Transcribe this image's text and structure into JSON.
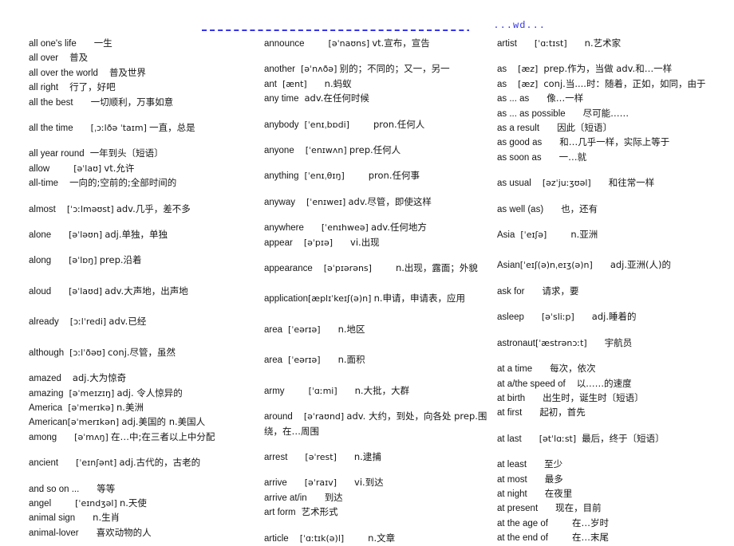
{
  "header": {
    "mark": "...wd...",
    "rule_color": "#3333ee"
  },
  "columns": [
    {
      "name": "column-1",
      "entries": [
        {
          "gap": "none",
          "headword": "all one's life",
          "sp": 3,
          "phonetic": "",
          "definition": "一生"
        },
        {
          "gap": "none",
          "headword": "all over",
          "sp": 2,
          "phonetic": "",
          "definition": "普及"
        },
        {
          "gap": "none",
          "headword": "all over the world",
          "sp": 2,
          "phonetic": "",
          "definition": "普及世界"
        },
        {
          "gap": "none",
          "headword": "all right",
          "sp": 2,
          "phonetic": "",
          "definition": "行了，好吧"
        },
        {
          "gap": "none",
          "headword": "all the best",
          "sp": 3,
          "phonetic": "",
          "definition": "一切顺利，万事如意"
        },
        {
          "gap": "m",
          "headword": "all the time",
          "sp": 3,
          "phonetic": "[ˌɔːlðə ˈtaɪm]",
          "definition": "一直，总是"
        },
        {
          "gap": "m",
          "headword": "all year round",
          "sp": 1,
          "phonetic": "",
          "definition": "一年到头〔短语〕"
        },
        {
          "gap": "none",
          "headword": "allow",
          "sp": 4,
          "phonetic": "[əˈlaʊ]",
          "definition": "vt.允许"
        },
        {
          "gap": "none",
          "headword": "all-time",
          "sp": 2,
          "phonetic": "",
          "definition": "一向的;空前的;全部时间的"
        },
        {
          "gap": "m",
          "headword": "almost",
          "sp": 2,
          "phonetic": "[ˈɔːlməʊst]",
          "definition": "adv.几乎，差不多"
        },
        {
          "gap": "m",
          "headword": "alone",
          "sp": 3,
          "phonetic": "[əˈləʊn]",
          "definition": "adj.单独，单独"
        },
        {
          "gap": "m",
          "headword": "along",
          "sp": 3,
          "phonetic": "[əˈlɒŋ]",
          "definition": "prep.沿着"
        },
        {
          "gap": "l",
          "headword": "aloud",
          "sp": 3,
          "phonetic": "[əˈlaʊd]",
          "definition": "adv.大声地，出声地"
        },
        {
          "gap": "l",
          "headword": "already",
          "sp": 2,
          "phonetic": "[ɔːlˈredi]",
          "definition": "adv.已经"
        },
        {
          "gap": "l",
          "headword": "although",
          "sp": 1,
          "phonetic": "[ɔːlˈðəʊ]",
          "definition": "conj.尽管，虽然"
        },
        {
          "gap": "m",
          "headword": "amazed",
          "sp": 2,
          "phonetic": "",
          "definition": "adj.大为惊奇"
        },
        {
          "gap": "none",
          "headword": "amazing",
          "sp": 1,
          "phonetic": "[əˈmeɪzɪŋ]",
          "definition": "adj. 令人惊异的"
        },
        {
          "gap": "none",
          "headword": "America",
          "sp": 1,
          "phonetic": "[əˈmerɪkə]",
          "definition": "n.美洲"
        },
        {
          "gap": "none",
          "headword": "American",
          "sp": 0,
          "phonetic": "[əˈmerɪkən]",
          "definition": "adj.美国的 n.美国人"
        },
        {
          "gap": "none",
          "headword": "among",
          "sp": 3,
          "phonetic": "[əˈmʌŋ]",
          "definition": "在…中;在三者以上中分配"
        },
        {
          "gap": "m",
          "headword": "ancient",
          "sp": 3,
          "phonetic": "[ˈeɪnʃənt]",
          "definition": "adj.古代的，古老的"
        },
        {
          "gap": "m",
          "headword": "and so on ...",
          "sp": 3,
          "phonetic": "",
          "definition": "等等"
        },
        {
          "gap": "none",
          "headword": "angel",
          "sp": 4,
          "phonetic": "[ˈeɪndʒəl]",
          "definition": "n.天使"
        },
        {
          "gap": "none",
          "headword": "animal sign",
          "sp": 3,
          "phonetic": "",
          "definition": "n.生肖"
        },
        {
          "gap": "none",
          "headword": "animal-lover",
          "sp": 3,
          "phonetic": "",
          "definition": "喜欢动物的人"
        }
      ]
    },
    {
      "name": "column-2",
      "entries": [
        {
          "gap": "none",
          "headword": "announce",
          "sp": 4,
          "phonetic": "[əˈnaʊns]",
          "definition": "vt.宣布，宣告"
        },
        {
          "gap": "m",
          "headword": "another",
          "sp": 1,
          "phonetic": "[əˈnʌðə]",
          "definition": "别的；不同的；又一，另一"
        },
        {
          "gap": "none",
          "headword": "ant",
          "sp": 1,
          "phonetic": "[ænt]",
          "definition": "n.蚂蚁",
          "sp2": 3
        },
        {
          "gap": "none",
          "headword": "any time",
          "sp": 1,
          "phonetic": "",
          "definition": "adv.在任何时候"
        },
        {
          "gap": "m",
          "headword": "anybody",
          "sp": 1,
          "phonetic": "[ˈenɪˌbɒdi]",
          "definition": "pron.任何人",
          "sp2": 4
        },
        {
          "gap": "m",
          "headword": "anyone",
          "sp": 2,
          "phonetic": "[ˈenɪwʌn]",
          "definition": "prep.任何人"
        },
        {
          "gap": "m",
          "headword": "anything",
          "sp": 1,
          "phonetic": "[ˈenɪˌθɪŋ]",
          "definition": "pron.任何事",
          "sp2": 4
        },
        {
          "gap": "m",
          "headword": "anyway",
          "sp": 2,
          "phonetic": "[ˈenɪweɪ]",
          "definition": "adv.尽管，即使这样"
        },
        {
          "gap": "m",
          "headword": "anywhere",
          "sp": 3,
          "phonetic": "[ˈenɪhweə]",
          "definition": "adv.任何地方"
        },
        {
          "gap": "none",
          "headword": "appear",
          "sp": 2,
          "phonetic": "[əˈpɪə]",
          "definition": "vi.出现",
          "sp2": 3
        },
        {
          "gap": "m",
          "headword": "appearance",
          "sp": 2,
          "phonetic": "[əˈpɪərəns]",
          "definition": "n.出现，露面；外貌",
          "sp2": 4
        },
        {
          "gap": "l",
          "headword": "application",
          "sp": 0,
          "phonetic": "[æplɪˈkeɪʃ(ə)n]",
          "definition": "n.申请，申请表，应用"
        },
        {
          "gap": "l",
          "headword": "area",
          "sp": 1,
          "phonetic": "[ˈeərɪə]",
          "definition": "n.地区",
          "sp2": 3
        },
        {
          "gap": "l",
          "headword": "area",
          "sp": 1,
          "phonetic": "[ˈeərɪə]",
          "definition": "n.面积",
          "sp2": 3
        },
        {
          "gap": "l",
          "headword": "army",
          "sp": 4,
          "phonetic": "[ˈɑːmi]",
          "definition": "n.大批，大群",
          "sp2": 3
        },
        {
          "gap": "m",
          "headword": "around",
          "sp": 2,
          "phonetic": "[əˈraʊnd]",
          "definition": "adv. 大约，到处，向各处  prep.围绕，在…周围",
          "wrap": true
        },
        {
          "gap": "m",
          "headword": "arrest",
          "sp": 3,
          "phonetic": "[əˈrest]",
          "definition": "n.逮捕",
          "sp2": 3
        },
        {
          "gap": "m",
          "headword": "arrive",
          "sp": 3,
          "phonetic": "[əˈraɪv]",
          "definition": "vi.到达",
          "sp2": 3
        },
        {
          "gap": "none",
          "headword": "arrive at/in",
          "sp": 3,
          "phonetic": "",
          "definition": "到达"
        },
        {
          "gap": "none",
          "headword": "art form",
          "sp": 1,
          "phonetic": "",
          "definition": "艺术形式"
        },
        {
          "gap": "m",
          "headword": "article",
          "sp": 2,
          "phonetic": "[ˈɑːtɪk(ə)l]",
          "definition": "n.文章",
          "sp2": 4
        }
      ]
    },
    {
      "name": "column-3",
      "entries": [
        {
          "gap": "none",
          "headword": "artist",
          "sp": 3,
          "phonetic": "[ˈɑːtɪst]",
          "definition": "n.艺术家",
          "sp2": 3
        },
        {
          "gap": "m",
          "headword": "as",
          "sp": 2,
          "phonetic": "[æz]",
          "definition": "prep.作为，当做  adv.和…一样",
          "sp2": 1
        },
        {
          "gap": "none",
          "headword": "as",
          "sp": 2,
          "phonetic": "[æz]",
          "definition": "conj.当....时：随着，正如，如同，由于",
          "sp2": 1
        },
        {
          "gap": "none",
          "headword": "as ... as",
          "sp": 3,
          "phonetic": "",
          "definition": "像…一样"
        },
        {
          "gap": "none",
          "headword": "as ... as possible",
          "sp": 3,
          "phonetic": "",
          "definition": "尽可能……"
        },
        {
          "gap": "none",
          "headword": "as a result",
          "sp": 3,
          "phonetic": "",
          "definition": "因此〔短语〕"
        },
        {
          "gap": "none",
          "headword": "as good as",
          "sp": 3,
          "phonetic": "",
          "definition": "和…几乎一样，实际上等于"
        },
        {
          "gap": "none",
          "headword": "as soon as",
          "sp": 3,
          "phonetic": "",
          "definition": "一…就"
        },
        {
          "gap": "m",
          "headword": "as usual",
          "sp": 2,
          "phonetic": "[əzˈjuːʒʊəl]",
          "definition": "和往常一样",
          "sp2": 3
        },
        {
          "gap": "m",
          "headword": "as well (as)",
          "sp": 3,
          "phonetic": "",
          "definition": "也，还有"
        },
        {
          "gap": "m",
          "headword": "Asia",
          "sp": 1,
          "phonetic": "[ˈeɪʃə]",
          "definition": "n.亚洲",
          "sp2": 4
        },
        {
          "gap": "l",
          "headword": "Asian",
          "sp": 0,
          "phonetic": "[ˈeɪʃ(ə)nˌeɪʒ(ə)n]",
          "definition": "adj.亚洲(人)的",
          "sp2": 3
        },
        {
          "gap": "m",
          "headword": "ask for",
          "sp": 3,
          "phonetic": "",
          "definition": "请求，要"
        },
        {
          "gap": "m",
          "headword": "asleep",
          "sp": 3,
          "phonetic": "[əˈsliːp]",
          "definition": "adj.睡着的",
          "sp2": 3
        },
        {
          "gap": "m",
          "headword": "astronaut",
          "sp": 0,
          "phonetic": "[ˈæstrənɔːt]",
          "definition": "宇航员",
          "sp2": 3
        },
        {
          "gap": "m",
          "headword": "at a time",
          "sp": 3,
          "phonetic": "",
          "definition": "每次，依次"
        },
        {
          "gap": "none",
          "headword": "at a/the speed of",
          "sp": 2,
          "phonetic": "",
          "definition": "以……的速度"
        },
        {
          "gap": "none",
          "headword": "at birth",
          "sp": 3,
          "phonetic": "",
          "definition": "出生时，诞生时〔短语〕"
        },
        {
          "gap": "none",
          "headword": "at first",
          "sp": 3,
          "phonetic": "",
          "definition": "起初，首先"
        },
        {
          "gap": "m",
          "headword": "at last",
          "sp": 3,
          "phonetic": "[ətˈlɑːst]",
          "definition": "最后，终于〔短语〕",
          "sp2": 1
        },
        {
          "gap": "m",
          "headword": "at least",
          "sp": 3,
          "phonetic": "",
          "definition": "至少"
        },
        {
          "gap": "none",
          "headword": "at most",
          "sp": 3,
          "phonetic": "",
          "definition": "最多"
        },
        {
          "gap": "none",
          "headword": "at night",
          "sp": 3,
          "phonetic": "",
          "definition": "在夜里"
        },
        {
          "gap": "none",
          "headword": "at present",
          "sp": 3,
          "phonetic": "",
          "definition": "现在，目前"
        },
        {
          "gap": "none",
          "headword": "at the age of",
          "sp": 4,
          "phonetic": "",
          "definition": "在…岁时"
        },
        {
          "gap": "none",
          "headword": "at the end of",
          "sp": 4,
          "phonetic": "",
          "definition": "在…末尾"
        }
      ]
    }
  ]
}
